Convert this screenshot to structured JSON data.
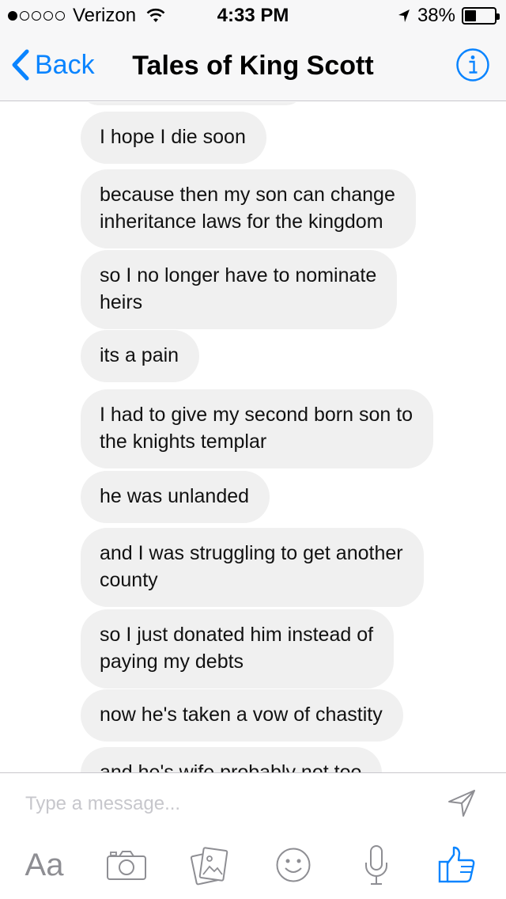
{
  "status_bar": {
    "carrier": "Verizon",
    "time": "4:33 PM",
    "battery_percent_text": "38%",
    "battery_level": 0.38
  },
  "nav": {
    "back_label": "Back",
    "title": "Tales of King Scott"
  },
  "messages": [
    {
      "lines": [
        "I hope I die soon"
      ]
    },
    {
      "lines": [
        "because then my son can change",
        "inheritance laws for the kingdom"
      ]
    },
    {
      "lines": [
        "so I no longer have to nominate",
        "heirs"
      ]
    },
    {
      "lines": [
        "its a pain"
      ]
    },
    {
      "lines": [
        "I had to give my second born son to",
        "the knights templar"
      ]
    },
    {
      "lines": [
        "he was unlanded"
      ]
    },
    {
      "lines": [
        "and I was struggling to get another",
        "county"
      ]
    },
    {
      "lines": [
        "so I just donated him instead of",
        "paying my debts"
      ]
    },
    {
      "lines": [
        "now he's taken a vow of chastity"
      ]
    },
    {
      "lines": [
        "and he's wife probably not too"
      ]
    }
  ],
  "composer": {
    "placeholder": "Type a message...",
    "aa_label": "Aa"
  },
  "colors": {
    "accent": "#0a84ff",
    "bubble_bg": "#f0f0f0",
    "icon_gray": "#8e8e93"
  }
}
